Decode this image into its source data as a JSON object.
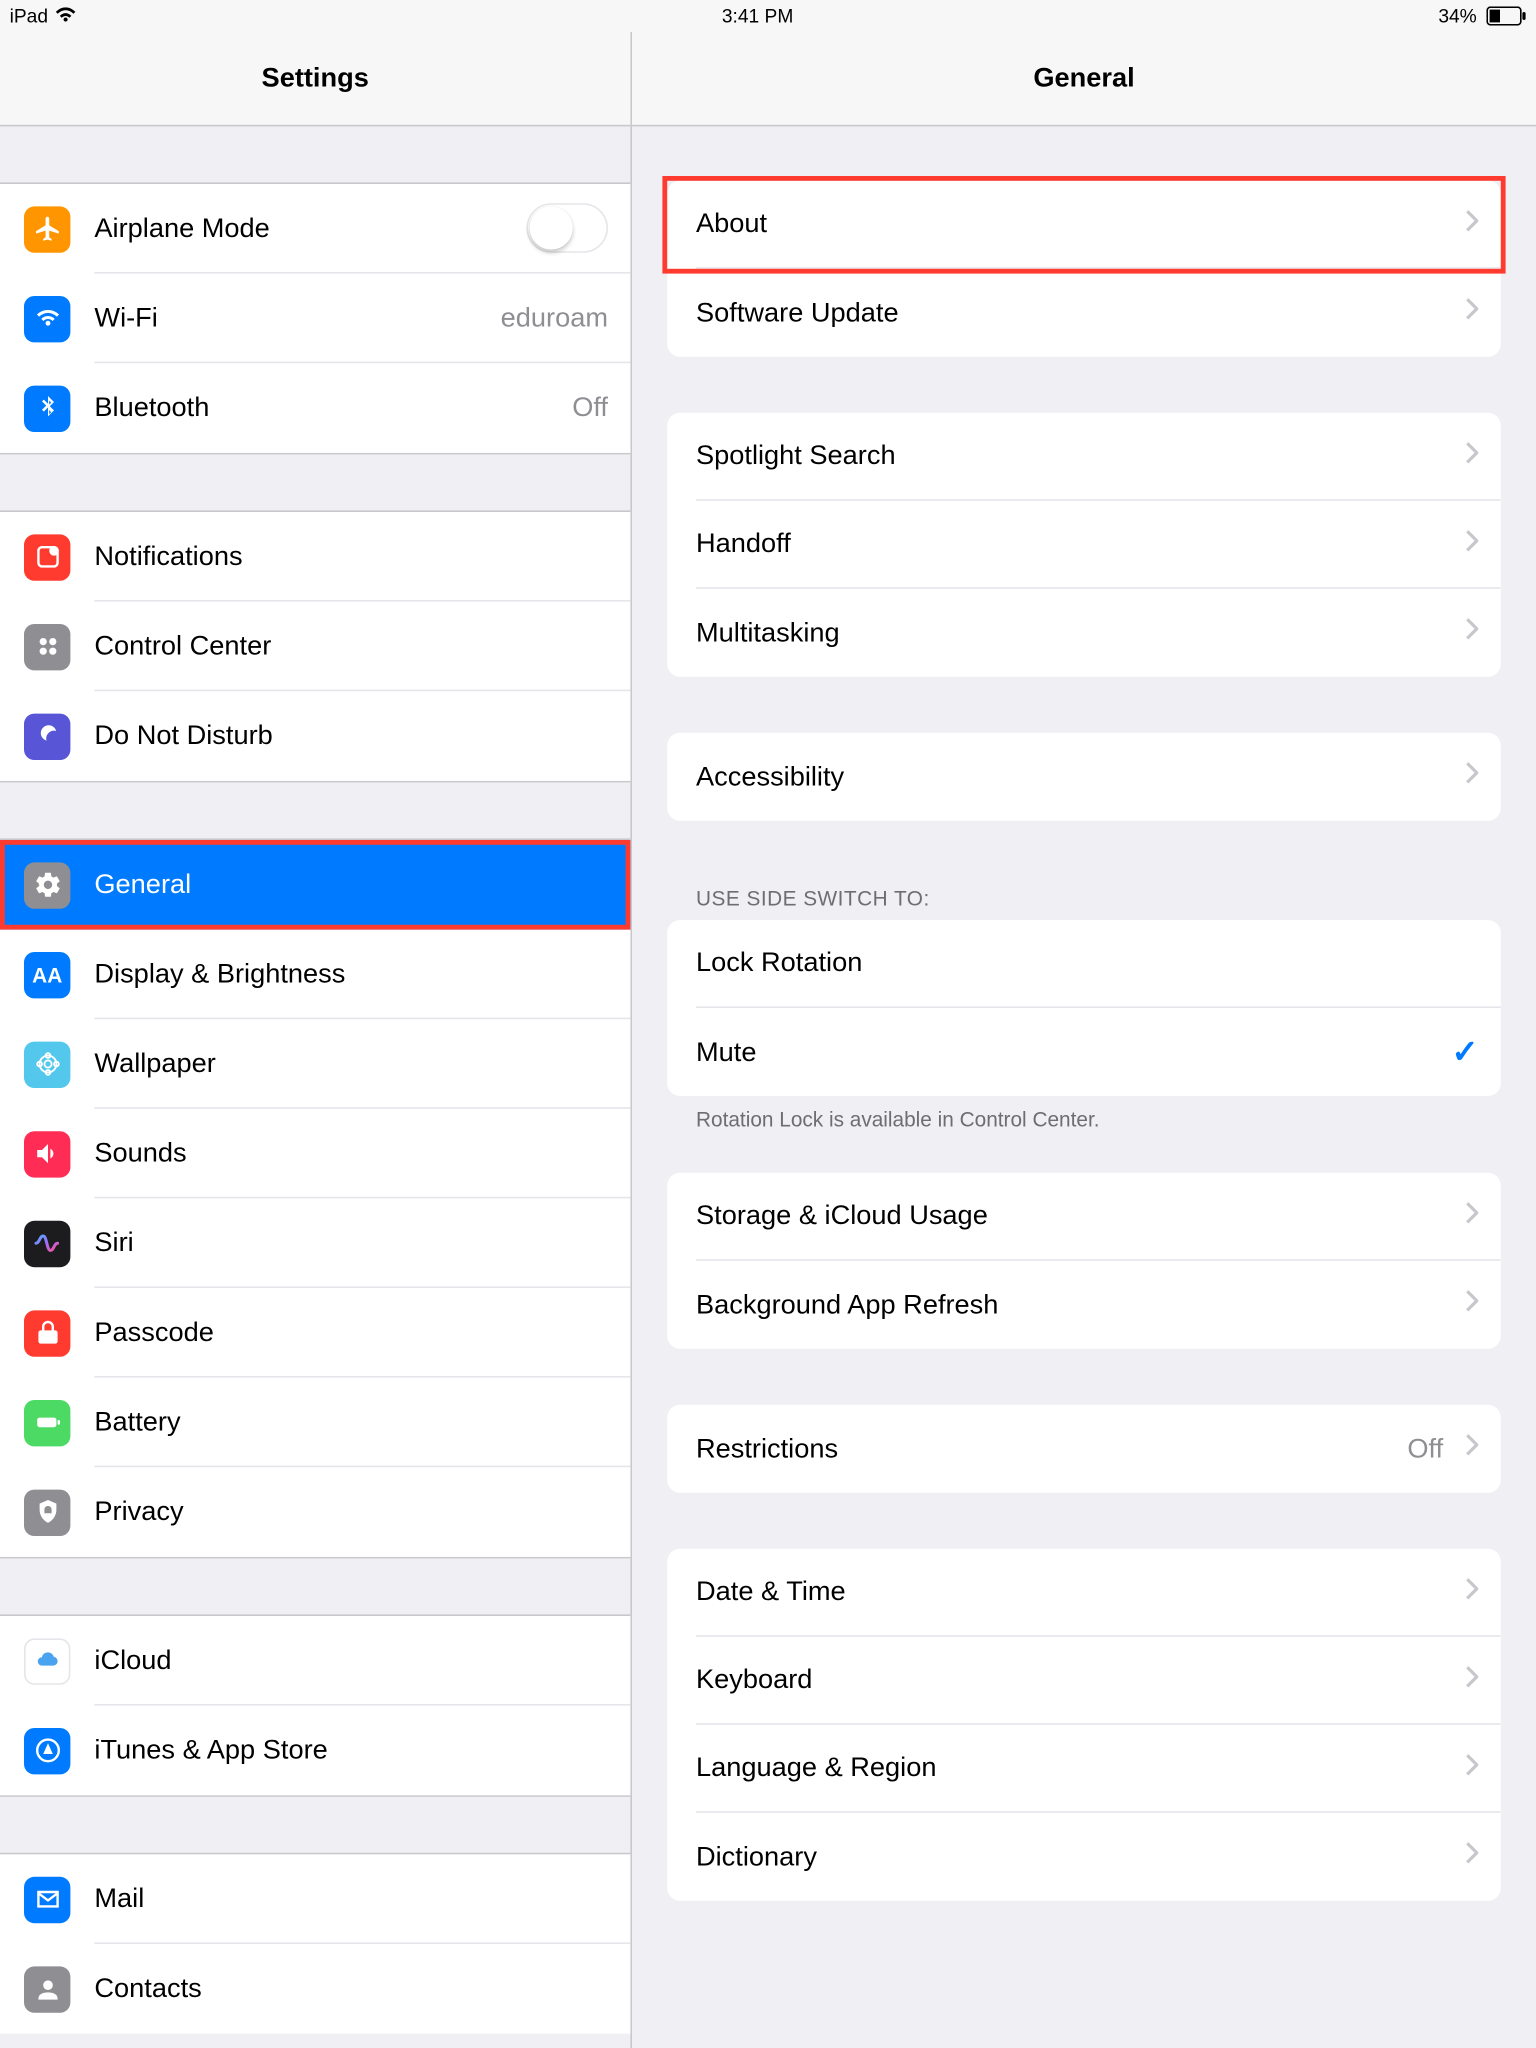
{
  "statusbar": {
    "device": "iPad",
    "time": "3:41 PM",
    "battery_pct": "34%"
  },
  "sidebar": {
    "title": "Settings",
    "groups": [
      {
        "items": [
          {
            "icon": "airplane-icon",
            "label": "Airplane Mode",
            "value": ""
          },
          {
            "icon": "wifi-icon",
            "label": "Wi-Fi",
            "value": "eduroam"
          },
          {
            "icon": "bluetooth-icon",
            "label": "Bluetooth",
            "value": "Off"
          }
        ]
      },
      {
        "items": [
          {
            "icon": "notifications-icon",
            "label": "Notifications"
          },
          {
            "icon": "control-center-icon",
            "label": "Control Center"
          },
          {
            "icon": "do-not-disturb-icon",
            "label": "Do Not Disturb"
          }
        ]
      },
      {
        "items": [
          {
            "icon": "general-icon",
            "label": "General"
          },
          {
            "icon": "display-icon",
            "label": "Display & Brightness"
          },
          {
            "icon": "wallpaper-icon",
            "label": "Wallpaper"
          },
          {
            "icon": "sounds-icon",
            "label": "Sounds"
          },
          {
            "icon": "siri-icon",
            "label": "Siri"
          },
          {
            "icon": "passcode-icon",
            "label": "Passcode"
          },
          {
            "icon": "battery-icon",
            "label": "Battery"
          },
          {
            "icon": "privacy-icon",
            "label": "Privacy"
          }
        ]
      },
      {
        "items": [
          {
            "icon": "icloud-icon",
            "label": "iCloud"
          },
          {
            "icon": "appstore-icon",
            "label": "iTunes & App Store"
          }
        ]
      },
      {
        "items": [
          {
            "icon": "mail-icon",
            "label": "Mail"
          },
          {
            "icon": "contacts-icon",
            "label": "Contacts"
          }
        ]
      }
    ]
  },
  "main": {
    "title": "General",
    "groups": {
      "about": {
        "items": [
          "About",
          "Software Update"
        ]
      },
      "search": {
        "items": [
          "Spotlight Search",
          "Handoff",
          "Multitasking"
        ]
      },
      "accessibility": {
        "items": [
          "Accessibility"
        ]
      },
      "sideswitch": {
        "header": "USE SIDE SWITCH TO:",
        "items": [
          "Lock Rotation",
          "Mute"
        ],
        "footer": "Rotation Lock is available in Control Center."
      },
      "storage": {
        "items": [
          "Storage & iCloud Usage",
          "Background App Refresh"
        ]
      },
      "restrictions": {
        "items": [
          {
            "label": "Restrictions",
            "value": "Off"
          }
        ]
      },
      "datetime": {
        "items": [
          "Date & Time",
          "Keyboard",
          "Language & Region",
          "Dictionary"
        ]
      }
    }
  }
}
